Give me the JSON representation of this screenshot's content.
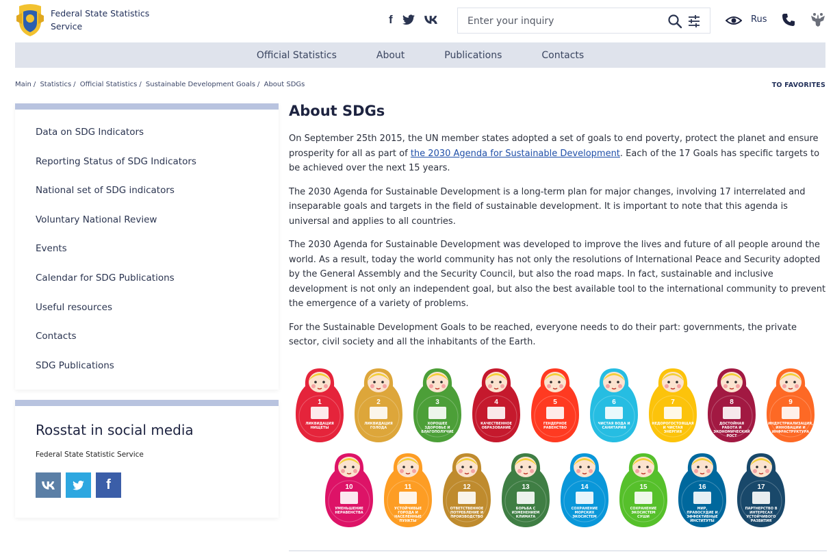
{
  "header": {
    "org_name": "Federal State Statistics Service",
    "social": [
      "f",
      "t",
      "vk"
    ],
    "search_placeholder": "Enter your inquiry",
    "lang": "Rus"
  },
  "nav": [
    "Official Statistics",
    "About",
    "Publications",
    "Contacts"
  ],
  "breadcrumb": [
    "Main",
    "Statistics",
    "Official Statistics",
    "Sustainable Development Goals",
    "About SDGs"
  ],
  "favorites": "TO FAVORITES",
  "sidebar": {
    "items": [
      "Data on SDG Indicators",
      "Reporting Status of SDG Indicators",
      "National set of SDG indicators",
      "Voluntary National Review",
      "Events",
      "Calendar for SDG Publications",
      "Useful resources",
      "Contacts",
      "SDG Publications"
    ],
    "social_title": "Rosstat in social media",
    "social_sub": "Federal State Statistic Service",
    "social_buttons": [
      "vk",
      "t",
      "f"
    ]
  },
  "content": {
    "title": "About SDGs",
    "p1_before": "On September 25th 2015, the UN member states adopted a set of goals to end poverty, protect the planet and ensure prosperity for all as part of ",
    "p1_link": "the 2030 Agenda for Sustainable Development",
    "p1_after": ". Each of the 17 Goals has specific targets to be achieved over the next 15 years.",
    "p2": "The 2030 Agenda for Sustainable Development is a long-term plan for major changes, involving 17 interrelated and inseparable goals and targets in the field of sustainable development. It is important to note that this agenda is universal and applies to all countries.",
    "p3": "The 2030 Agenda for Sustainable Development was developed to improve the lives and future of all people around the world. As a result, today the world community has not only the resolutions of International Peace and Security adopted by the General Assembly and the Security Council, but also the road maps. In fact, sustainable and inclusive development is not only an independent goal, but also the best available tool to the international community to prevent the emergence of a variety of problems.",
    "p4": "For the Sustainable Development Goals to be reached, everyone needs to do their part: governments, the private sector, civil society and all the inhabitants of the Earth."
  },
  "goals": [
    {
      "n": "1",
      "label": "ЛИКВИДАЦИЯ НИЩЕТЫ",
      "color": "#e5243b"
    },
    {
      "n": "2",
      "label": "ЛИКВИДАЦИЯ ГОЛОДА",
      "color": "#dda63a"
    },
    {
      "n": "3",
      "label": "ХОРОШЕЕ ЗДОРОВЬЕ И БЛАГОПОЛУЧИЕ",
      "color": "#4c9f38"
    },
    {
      "n": "4",
      "label": "КАЧЕСТВЕННОЕ ОБРАЗОВАНИЕ",
      "color": "#c5192d"
    },
    {
      "n": "5",
      "label": "ГЕНДЕРНОЕ РАВЕНСТВО",
      "color": "#ff3a21"
    },
    {
      "n": "6",
      "label": "ЧИСТАЯ ВОДА И САНИТАРИЯ",
      "color": "#26bde2"
    },
    {
      "n": "7",
      "label": "НЕДОРОГОСТОЯЩАЯ И ЧИСТАЯ ЭНЕРГИЯ",
      "color": "#fcc30b"
    },
    {
      "n": "8",
      "label": "ДОСТОЙНАЯ РАБОТА И ЭКОНОМИЧЕСКИЙ РОСТ",
      "color": "#a21942"
    },
    {
      "n": "9",
      "label": "ИНДУСТРИАЛИЗАЦИЯ, ИННОВАЦИИ И ИНФРАСТРУКТУРА",
      "color": "#fd6925"
    },
    {
      "n": "10",
      "label": "УМЕНЬШЕНИЕ НЕРАВЕНСТВА",
      "color": "#dd1367"
    },
    {
      "n": "11",
      "label": "УСТОЙЧИВЫЕ ГОРОДА И НАСЕЛЕННЫЕ ПУНКТЫ",
      "color": "#fd9d24"
    },
    {
      "n": "12",
      "label": "ОТВЕТСТВЕННОЕ ПОТРЕБЛЕНИЕ И ПРОИЗВОДСТВО",
      "color": "#bf8b2e"
    },
    {
      "n": "13",
      "label": "БОРЬБА С ИЗМЕНЕНИЕМ КЛИМАТА",
      "color": "#3f7e44"
    },
    {
      "n": "14",
      "label": "СОХРАНЕНИЕ МОРСКИХ ЭКОСИСТЕМ",
      "color": "#0a97d9"
    },
    {
      "n": "15",
      "label": "СОХРАНЕНИЕ ЭКОСИСТЕМ СУШИ",
      "color": "#56c02b"
    },
    {
      "n": "16",
      "label": "МИР, ПРАВОСУДИЕ И ЭФФЕКТИВНЫЕ ИНСТИТУТЫ",
      "color": "#00689d"
    },
    {
      "n": "17",
      "label": "ПАРТНЕРСТВО В ИНТЕРЕСАХ УСТОЙЧИВОГО РАЗВИТИЯ",
      "color": "#19486a"
    }
  ]
}
